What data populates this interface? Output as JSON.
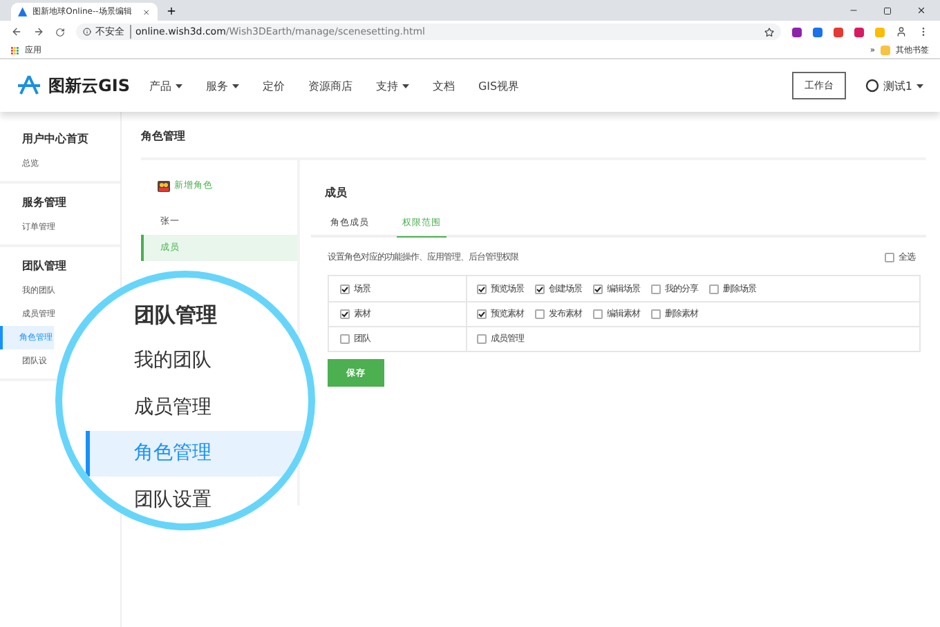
{
  "browser": {
    "tab_title": "图新地球Online--场景编辑",
    "security": "不安全",
    "url_host": "online.wish3d.com",
    "url_path": "/Wish3DEarth/manage/scenesetting.html",
    "bookmark": "应用",
    "more": "»",
    "other_bookmarks": "其他书签"
  },
  "nav": {
    "logo": "图新云GIS",
    "items": [
      {
        "label": "产品",
        "dropdown": true
      },
      {
        "label": "服务",
        "dropdown": true
      },
      {
        "label": "定价",
        "dropdown": false
      },
      {
        "label": "资源商店",
        "dropdown": false
      },
      {
        "label": "支持",
        "dropdown": true
      },
      {
        "label": "文档",
        "dropdown": false
      },
      {
        "label": "GIS视界",
        "dropdown": false
      }
    ],
    "workbench": "工作台",
    "user": "测试1"
  },
  "sidebar": {
    "groups": [
      {
        "title": "用户中心首页",
        "items": [
          {
            "label": "总览",
            "selected": false
          }
        ]
      },
      {
        "title": "服务管理",
        "items": [
          {
            "label": "订单管理",
            "selected": false
          }
        ]
      },
      {
        "title": "团队管理",
        "items": [
          {
            "label": "我的团队",
            "selected": false
          },
          {
            "label": "成员管理",
            "selected": false
          },
          {
            "label": "角色管理",
            "selected": true
          },
          {
            "label": "团队设",
            "selected": false
          }
        ]
      }
    ]
  },
  "roles": {
    "title": "角色管理",
    "add": "新增角色",
    "list": [
      {
        "label": "张一",
        "selected": false
      },
      {
        "label": "成员",
        "selected": true
      }
    ]
  },
  "detail": {
    "title": "成员",
    "tabs": [
      {
        "label": "角色成员",
        "selected": false
      },
      {
        "label": "权限范围",
        "selected": true
      }
    ],
    "description": "设置角色对应的功能操作、应用管理、后台管理权限",
    "select_all": {
      "label": "全选",
      "checked": false
    },
    "permissions": [
      {
        "module": {
          "label": "场景",
          "checked": true
        },
        "actions": [
          {
            "label": "预览场景",
            "checked": true
          },
          {
            "label": "创建场景",
            "checked": true
          },
          {
            "label": "编辑场景",
            "checked": true
          },
          {
            "label": "我的分享",
            "checked": false
          },
          {
            "label": "删除场景",
            "checked": false
          }
        ]
      },
      {
        "module": {
          "label": "素材",
          "checked": true
        },
        "actions": [
          {
            "label": "预览素材",
            "checked": true
          },
          {
            "label": "发布素材",
            "checked": false
          },
          {
            "label": "编辑素材",
            "checked": false
          },
          {
            "label": "删除素材",
            "checked": false
          }
        ]
      },
      {
        "module": {
          "label": "团队",
          "checked": false
        },
        "actions": [
          {
            "label": "成员管理",
            "checked": false
          }
        ]
      }
    ],
    "save": "保存"
  },
  "magnifier": {
    "title": "团队管理",
    "items": [
      {
        "label": "我的团队",
        "selected": false
      },
      {
        "label": "成员管理",
        "selected": false
      },
      {
        "label": "角色管理",
        "selected": true
      },
      {
        "label": "团队设置",
        "selected": false
      }
    ]
  }
}
